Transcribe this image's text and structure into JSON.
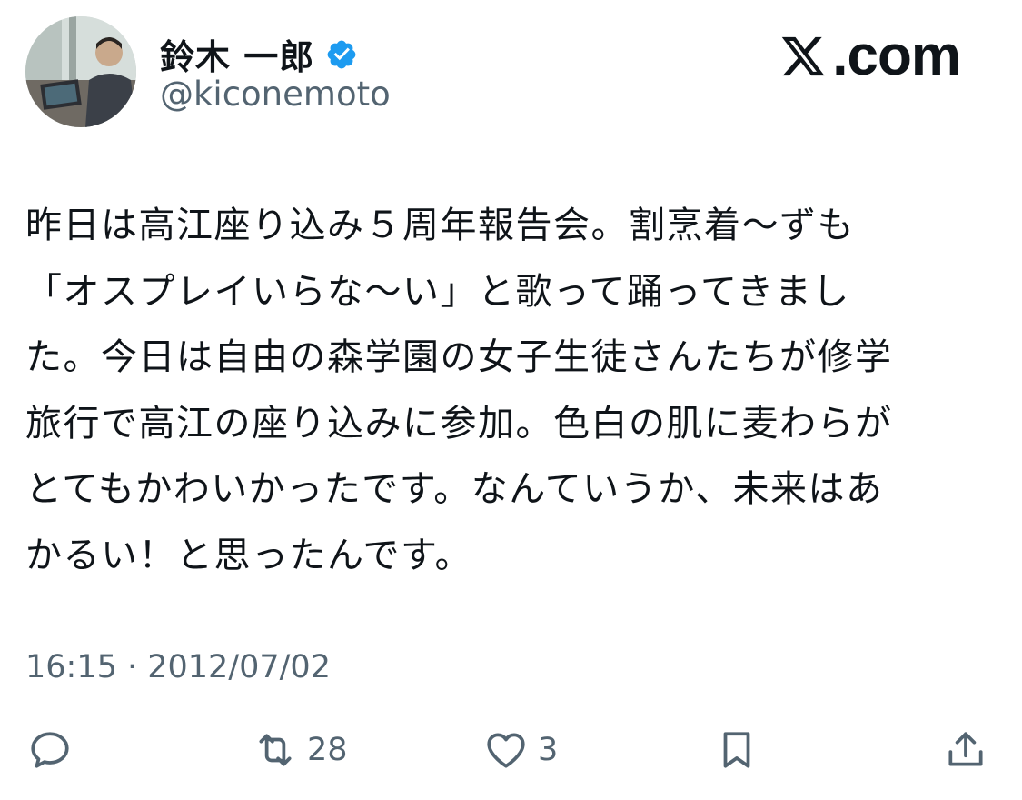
{
  "user": {
    "display_name": "鈴木 一郎",
    "handle": "@kiconemoto",
    "verified": true,
    "verified_color": "#1d9bf0"
  },
  "brand": {
    "label": ".com",
    "logo_icon": "x-logo-icon"
  },
  "tweet": {
    "text": "昨日は高江座り込み５周年報告会。割烹着〜ずも\n「オスプレイいらな〜い」と歌って踊ってきまし\nた。今日は自由の森学園の女子生徒さんたちが修学\n旅行で高江の座り込みに参加。色白の肌に麦わらが\nとてもかわいかったです。なんていうか、未来はあ\nかるい！と思ったんです。",
    "timestamp": "16:15 · 2012/07/02"
  },
  "actions": {
    "reply": {
      "icon": "reply-icon"
    },
    "retweet": {
      "icon": "retweet-icon",
      "count": "28"
    },
    "like": {
      "icon": "heart-icon",
      "count": "3"
    },
    "bookmark": {
      "icon": "bookmark-icon"
    },
    "share": {
      "icon": "share-icon"
    }
  },
  "colors": {
    "text": "#0f1419",
    "secondary": "#536471",
    "background": "#ffffff"
  }
}
